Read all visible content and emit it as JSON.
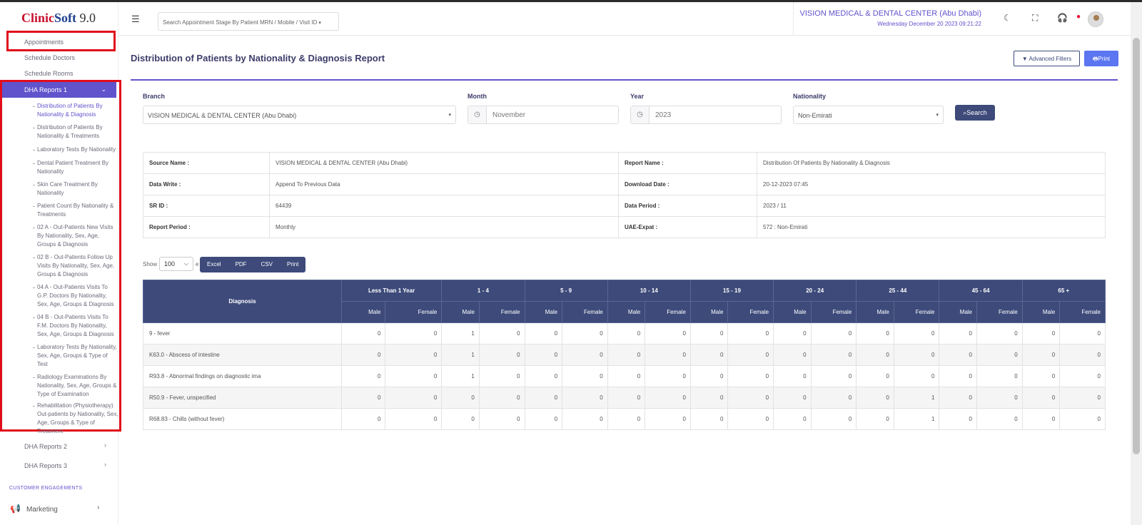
{
  "logo": {
    "part1": "Clinic",
    "part2": "Soft",
    "version": " 9.0"
  },
  "sidebar": {
    "top_items": [
      "Appointments",
      "Schedule Doctors",
      "Schedule Rooms"
    ],
    "dha1": "DHA Reports 1",
    "dha1_chevron": "⌄",
    "sub_items": [
      "Distribution of Patients By Nationality & Diagnosis",
      "Distribution of Patients By Nationality & Treatments",
      "Laboratory Tests By Nationality",
      "Dental Patient Treatment By Nationality",
      "Skin Care Treatment By Nationality",
      "Patient Count By Nationality & Treatments",
      "02 A - Out-Patients New Visits By Nationality, Sex, Age, Groups & Diagnosis",
      "02 B - Out-Patients Follow Up Visits By Nationality, Sex, Age, Groups & Diagnosis",
      "04 A - Out-Patients Visits To G.P. Doctors By Nationality, Sex, Age, Groups & Diagnosis",
      "04 B - Out-Patients Visits To F.M. Doctors By Nationality, Sex, Age, Groups & Diagnosis",
      "Laboratory Tests By Nationality, Sex, Age, Groups & Type of Test",
      "Radiology Examinations By Nationality, Sex, Age, Groups & Type of Examination",
      "Rehabilitation (Physiotherapy) Out-patients by Nationality, Sex, Age, Groups & Type of Treatment"
    ],
    "dha2": "DHA Reports 2",
    "dha3": "DHA Reports 3",
    "chevron": "›",
    "section_title": "CUSTOMER ENGAGEMENTS",
    "marketing": "Marketing"
  },
  "header": {
    "search_placeholder": "Search Appointment Stage By Patient MRN / Mobile / Visit ID",
    "caret": "▾",
    "center_name": "VISION MEDICAL & DENTAL CENTER (Abu Dhabi)",
    "date": "Wednesday December 20 2023 09:21:22"
  },
  "page": {
    "title": "Distribution of Patients by Nationality & Diagnosis Report",
    "advanced_filters": "Advanced Filters",
    "print": "Print"
  },
  "filters": {
    "branch_label": "Branch",
    "branch_value": "VISION MEDICAL & DENTAL CENTER (Abu Dhabi)",
    "month_label": "Month",
    "month_value": "November",
    "year_label": "Year",
    "year_value": "2023",
    "nationality_label": "Nationality",
    "nationality_value": "Non-Emirati",
    "search": "Search"
  },
  "info": {
    "source_name_label": "Source Name :",
    "source_name": "VISION MEDICAL & DENTAL CENTER (Abu Dhabi)",
    "report_name_label": "Report Name :",
    "report_name": "Distribution Of Patients By Nationality & Diagnosis",
    "data_write_label": "Data Write :",
    "data_write": "Append To Previous Data",
    "download_date_label": "Download Date :",
    "download_date": "20-12-2023 07:45",
    "sr_id_label": "SR ID :",
    "sr_id": "64439",
    "data_period_label": "Data Period :",
    "data_period": "2023 / 11",
    "report_period_label": "Report Period :",
    "report_period": "Monthly",
    "uae_expat_label": "UAE-Expat :",
    "uae_expat": "572 : Non-Emirati"
  },
  "table_controls": {
    "show": "Show",
    "entries_value": "100",
    "entries_caret": "⌵",
    "entries_suffix": "e",
    "buttons": [
      "Excel",
      "PDF",
      "CSV",
      "Print"
    ]
  },
  "table": {
    "diagnosis_header": "Diagnosis",
    "age_groups": [
      "Less Than 1 Year",
      "1 - 4",
      "5 - 9",
      "10 - 14",
      "15 - 19",
      "20 - 24",
      "25 - 44",
      "45 - 64",
      "65 +"
    ],
    "male": "Male",
    "female": "Female",
    "rows": [
      {
        "dx": "9 - fever",
        "v": [
          "0",
          "0",
          "1",
          "0",
          "0",
          "0",
          "0",
          "0",
          "0",
          "0",
          "0",
          "0",
          "0",
          "0",
          "0",
          "0",
          "0",
          "0"
        ]
      },
      {
        "dx": "K63.0 - Abscess of intestine",
        "v": [
          "0",
          "0",
          "1",
          "0",
          "0",
          "0",
          "0",
          "0",
          "0",
          "0",
          "0",
          "0",
          "0",
          "0",
          "0",
          "0",
          "0",
          "0"
        ]
      },
      {
        "dx": "R93.8 - Abnormal findings on diagnostic ima",
        "v": [
          "0",
          "0",
          "1",
          "0",
          "0",
          "0",
          "0",
          "0",
          "0",
          "0",
          "0",
          "0",
          "0",
          "0",
          "0",
          "0",
          "0",
          "0"
        ]
      },
      {
        "dx": "R50.9 - Fever, unspecified",
        "v": [
          "0",
          "0",
          "0",
          "0",
          "0",
          "0",
          "0",
          "0",
          "0",
          "0",
          "0",
          "0",
          "0",
          "1",
          "0",
          "0",
          "0",
          "0"
        ]
      },
      {
        "dx": "R68.83 - Chills (without fever)",
        "v": [
          "0",
          "0",
          "0",
          "0",
          "0",
          "0",
          "0",
          "0",
          "0",
          "0",
          "0",
          "0",
          "0",
          "1",
          "0",
          "0",
          "0",
          "0"
        ]
      }
    ]
  }
}
